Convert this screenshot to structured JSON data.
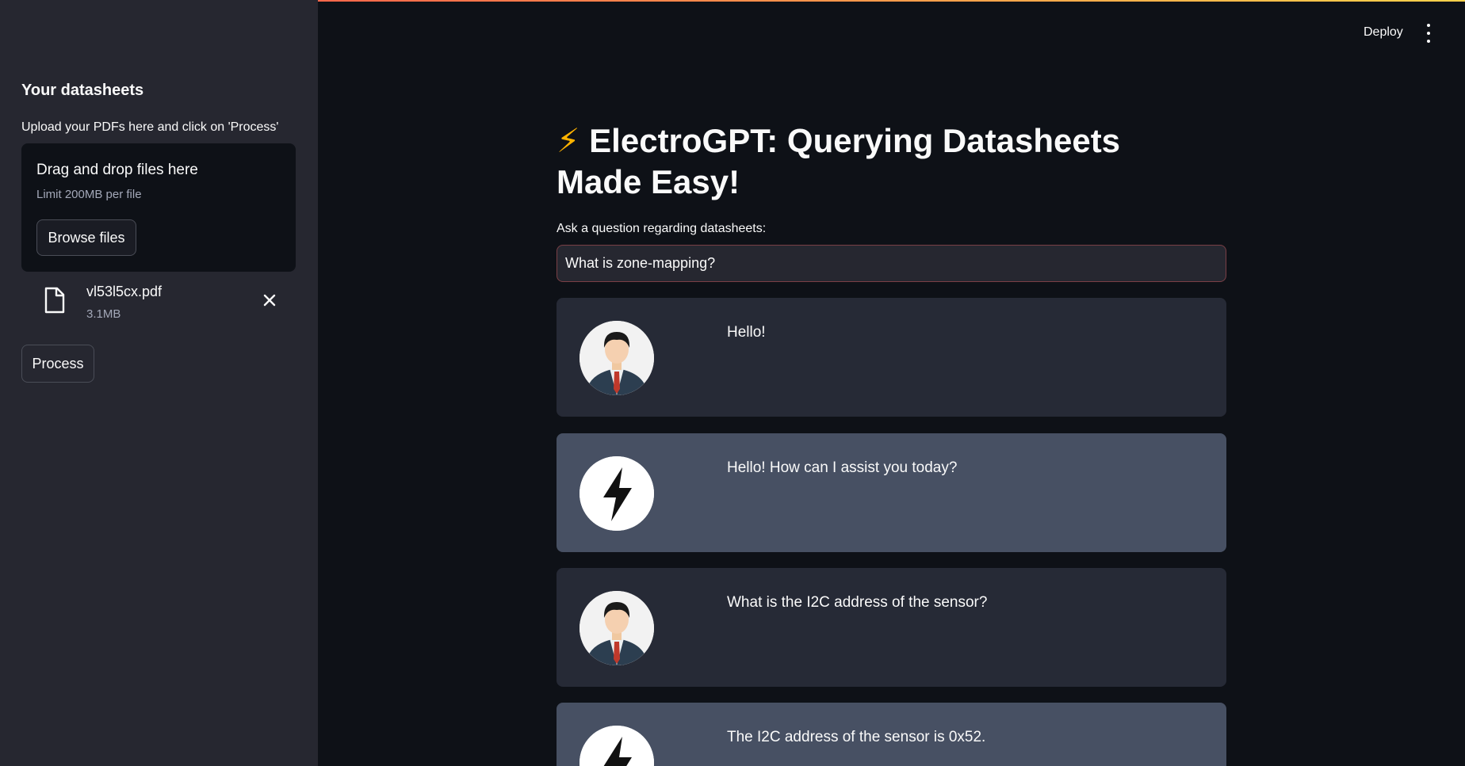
{
  "sidebar": {
    "title": "Your datasheets",
    "caption": "Upload your PDFs here and click on 'Process'",
    "dropzone": {
      "main_text": "Drag and drop files here",
      "limit_text": "Limit 200MB per file",
      "browse_label": "Browse files"
    },
    "file": {
      "name": "vl53l5cx.pdf",
      "size": "3.1MB"
    },
    "process_label": "Process"
  },
  "header": {
    "deploy_label": "Deploy"
  },
  "main": {
    "title_emoji": "⚡",
    "title_text": "ElectroGPT: Querying Datasheets Made Easy!",
    "question_label": "Ask a question regarding datasheets:",
    "question_value": "What is zone-mapping?",
    "messages": [
      {
        "role": "user",
        "avatar": "person-avatar",
        "text": "Hello!"
      },
      {
        "role": "bot",
        "avatar": "lightning-avatar",
        "text": "Hello! How can I assist you today?"
      },
      {
        "role": "user",
        "avatar": "person-avatar",
        "text": "What is the I2C address of the sensor?"
      },
      {
        "role": "bot",
        "avatar": "lightning-avatar",
        "text": "The I2C address of the sensor is 0x52."
      }
    ]
  },
  "colors": {
    "background": "#0e1117",
    "sidebar": "#262730",
    "user_message": "#262a36",
    "bot_message": "#475063",
    "accent": "#ff4b4b"
  }
}
